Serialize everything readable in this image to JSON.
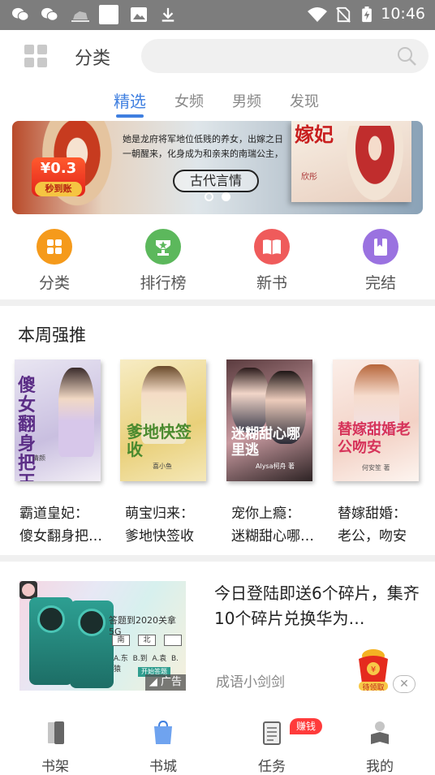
{
  "status_bar": {
    "time": "10:46",
    "icons": [
      "wechat-icon",
      "wechat-icon",
      "cloud-icon",
      "blank-notification-icon",
      "image-icon",
      "download-icon",
      "wifi-icon",
      "no-sim-icon",
      "battery-charging-icon"
    ]
  },
  "header": {
    "title": "分类",
    "search_placeholder": ""
  },
  "tabs": [
    {
      "label": "精选",
      "active": true
    },
    {
      "label": "女频",
      "active": false
    },
    {
      "label": "男频",
      "active": false
    },
    {
      "label": "发现",
      "active": false
    }
  ],
  "banner": {
    "tagline_line1": "她是龙府将军地位低贱的养女，出嫁之日",
    "tagline_line2": "一朝醒来，化身成为和亲来的南瑞公主，",
    "genre": "古代言情",
    "price": "¥0.3",
    "price_sub": "秒到账",
    "book_title": "嫁妃",
    "book_sub": "欣彤",
    "dots": 2,
    "active_dot": 1
  },
  "shortcuts": [
    {
      "label": "分类",
      "icon": "category-icon",
      "color": "#f59a1b"
    },
    {
      "label": "排行榜",
      "icon": "ranking-icon",
      "color": "#5cb85c"
    },
    {
      "label": "新书",
      "icon": "new-book-icon",
      "color": "#ef5b5b"
    },
    {
      "label": "完结",
      "icon": "completed-icon",
      "color": "#9a72e0"
    }
  ],
  "weekly": {
    "title": "本周强推",
    "books": [
      {
        "title_line1": "霸道皇妃：",
        "title_line2": "傻女翻身把…",
        "cover_text": "傻女翻身把王上",
        "cover_author": "清颜"
      },
      {
        "title_line1": "萌宝归来：",
        "title_line2": "爹地快签收",
        "cover_text": "爹地快签收",
        "cover_author": "喜小鱼"
      },
      {
        "title_line1": "宠你上瘾：",
        "title_line2": "迷糊甜心哪…",
        "cover_text": "迷糊甜心哪里逃",
        "cover_author": "Alysa柯舟 著"
      },
      {
        "title_line1": "替嫁甜婚：",
        "title_line2": "老公，吻安",
        "cover_text": "替嫁甜婚老公吻安",
        "cover_author": "何安笙 著"
      }
    ]
  },
  "ad": {
    "text": "今日登陆即送6个碎片，集齐10个碎片兑换华为…",
    "source": "成语小剑剑",
    "tag": "广告",
    "quiz": "答题到2020关拿5G",
    "options": [
      "南",
      "北",
      "A.东",
      "B.到",
      "A.袁",
      "B.猿"
    ],
    "start_label": "开始答题",
    "reward_label": "待领取",
    "close": "✕"
  },
  "bottom_nav": [
    {
      "label": "书架",
      "icon": "bookshelf-icon",
      "active": false
    },
    {
      "label": "书城",
      "icon": "bookstore-icon",
      "active": true
    },
    {
      "label": "任务",
      "icon": "task-icon",
      "active": false
    },
    {
      "label": "我的",
      "icon": "profile-icon",
      "active": false
    }
  ],
  "task_badge": "赚钱",
  "colors": {
    "accent": "#3f7fe0",
    "status_bar": "#7d7d7d",
    "badge_red": "#ff3b3b"
  }
}
